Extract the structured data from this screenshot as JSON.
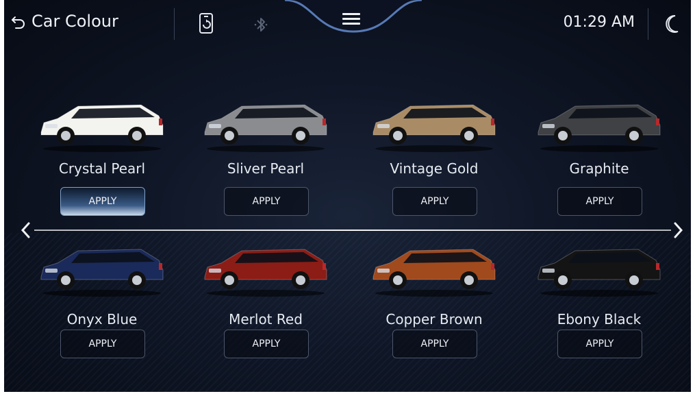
{
  "header": {
    "title": "Car Colour",
    "time": "01:29 AM"
  },
  "icons": {
    "back": "back-arrow-icon",
    "phone": "phone-sync-icon",
    "bluetooth": "bluetooth-icon",
    "menu": "hamburger-menu-icon",
    "night": "night-mode-moon-icon",
    "left": "chevron-left-icon",
    "right": "chevron-right-icon"
  },
  "colors": {
    "accent": "#7fa1c9",
    "text": "#f0f2f6"
  },
  "cars": [
    {
      "name": "Crystal Pearl",
      "apply": "APPLY",
      "color": "#f3f3ef",
      "active": true
    },
    {
      "name": "Sliver Pearl",
      "apply": "APPLY",
      "color": "#8a8c90",
      "active": false
    },
    {
      "name": "Vintage Gold",
      "apply": "APPLY",
      "color": "#a98c66",
      "active": false
    },
    {
      "name": "Graphite",
      "apply": "APPLY",
      "color": "#3f4144",
      "active": false
    },
    {
      "name": "Onyx Blue",
      "apply": "APPLY",
      "color": "#1a2a5a",
      "active": false
    },
    {
      "name": "Merlot Red",
      "apply": "APPLY",
      "color": "#8b1d16",
      "active": false
    },
    {
      "name": "Copper Brown",
      "apply": "APPLY",
      "color": "#a04a1e",
      "active": false
    },
    {
      "name": "Ebony Black",
      "apply": "APPLY",
      "color": "#141414",
      "active": false
    }
  ]
}
